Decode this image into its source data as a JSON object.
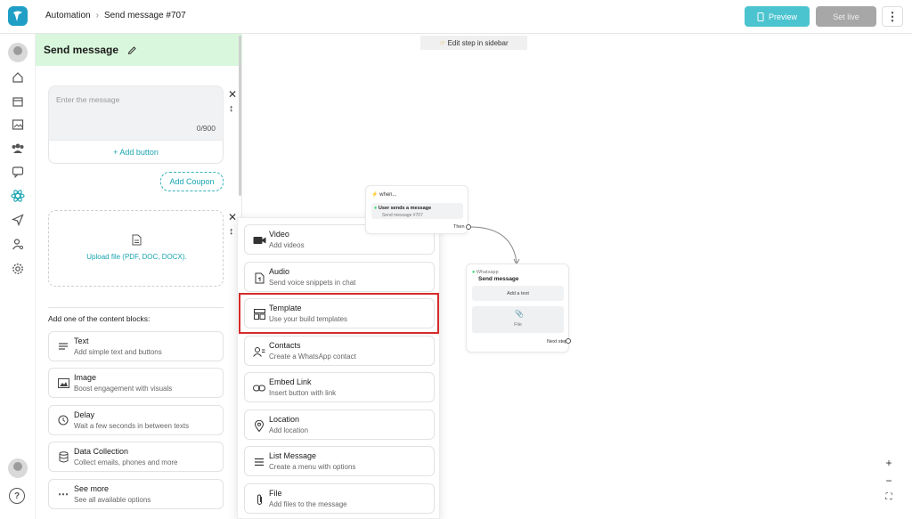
{
  "header": {
    "breadcrumb_root": "Automation",
    "breadcrumb_current": "Send message #707",
    "preview_label": "Preview",
    "set_live_label": "Set live"
  },
  "panel": {
    "title": "Send message",
    "message_placeholder": "Enter the message",
    "char_count": "0/900",
    "add_button_label": "+ Add button",
    "add_coupon_label": "Add Coupon",
    "upload_label": "Upload file (PDF, DOC, DOCX).",
    "content_blocks_heading": "Add one of the content blocks:",
    "content_blocks": [
      {
        "title": "Text",
        "subtitle": "Add simple text and buttons",
        "icon": "text-lines-icon"
      },
      {
        "title": "Image",
        "subtitle": "Boost engagement with visuals",
        "icon": "image-icon"
      },
      {
        "title": "Delay",
        "subtitle": "Wait a few seconds in between texts",
        "icon": "clock-icon"
      },
      {
        "title": "Data Collection",
        "subtitle": "Collect emails, phones and more",
        "icon": "database-icon"
      },
      {
        "title": "See more",
        "subtitle": "See all available options",
        "icon": "more-dots-icon"
      }
    ]
  },
  "dropdown": {
    "items": [
      {
        "title": "Video",
        "subtitle": "Add videos",
        "icon": "video-camera-icon"
      },
      {
        "title": "Audio",
        "subtitle": "Send voice snippets in chat",
        "icon": "audio-file-icon"
      },
      {
        "title": "Template",
        "subtitle": "Use your build templates",
        "icon": "template-layout-icon"
      },
      {
        "title": "Contacts",
        "subtitle": "Create a WhatsApp contact",
        "icon": "contacts-icon"
      },
      {
        "title": "Embed Link",
        "subtitle": "Insert button with link",
        "icon": "link-icon"
      },
      {
        "title": "Location",
        "subtitle": "Add location",
        "icon": "location-pin-icon"
      },
      {
        "title": "List Message",
        "subtitle": "Create a menu with options",
        "icon": "list-icon"
      },
      {
        "title": "File",
        "subtitle": "Add files to the message",
        "icon": "paperclip-icon"
      }
    ]
  },
  "canvas": {
    "edit_hint": "Edit step in sidebar",
    "trigger_node": {
      "header": "when...",
      "card_title": "User sends a message",
      "card_sub": "Send message #707",
      "then_label": "Then"
    },
    "action_node": {
      "channel": "Whatsapp",
      "title": "Send message",
      "add_text": "Add a text",
      "file_label": "File",
      "next_step": "Next step"
    }
  },
  "colors": {
    "accent": "#4cc4cf",
    "link": "#1aa5b0",
    "panel_header": "#d9f7dc",
    "highlight": "#d52b2b"
  }
}
